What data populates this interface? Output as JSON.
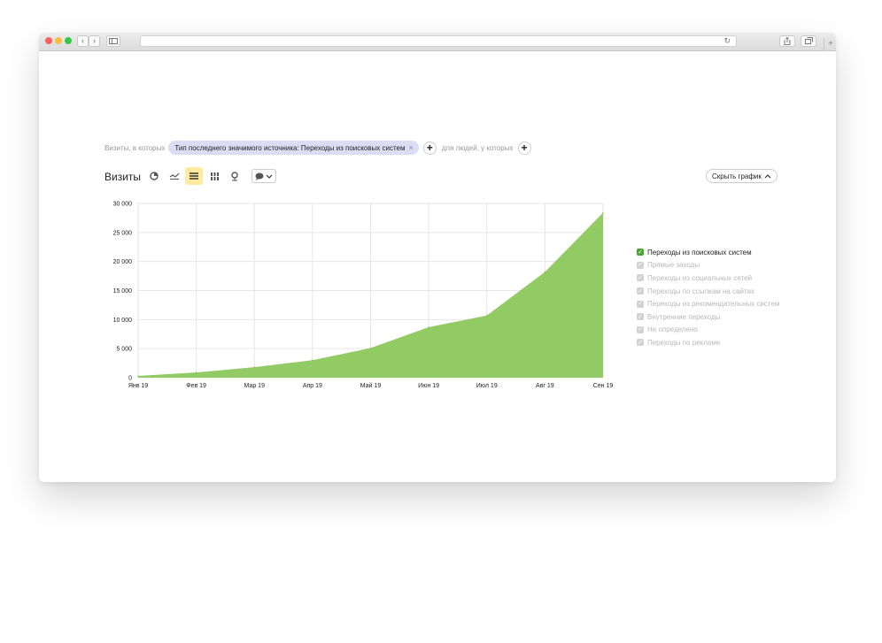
{
  "browser": {
    "back_glyph": "‹",
    "forward_glyph": "›",
    "reload_glyph": "↻",
    "icons": [
      "back-icon",
      "forward-icon",
      "sidebar-icon",
      "reload-icon",
      "share-icon",
      "tabs-icon",
      "new-tab-icon"
    ]
  },
  "filter": {
    "prefix": "Визиты, в которых",
    "chip_label": "Тип последнего значимого источника: Переходы из поисковых систем",
    "chip_remove": "×",
    "add": "+",
    "people_text": "для людей, у которых"
  },
  "header": {
    "title": "Визиты",
    "hide_button": "Скрыть график",
    "tool_icons": [
      "pie-chart-icon",
      "line-chart-icon",
      "stacked-area-icon",
      "bar-chart-icon",
      "map-pin-icon",
      "comment-icon"
    ],
    "active_tool": "stacked-area-icon"
  },
  "chart_data": {
    "type": "area",
    "title": "",
    "xlabel": "",
    "ylabel": "",
    "categories": [
      "Янв 19",
      "Фев 19",
      "Мар 19",
      "Апр 19",
      "Май 19",
      "Июн 19",
      "Июл 19",
      "Авг 19",
      "Сен 19"
    ],
    "series": [
      {
        "name": "Переходы из поисковых систем",
        "values": [
          300,
          900,
          1800,
          3000,
          5100,
          8700,
          10700,
          18200,
          28400
        ],
        "color": "#8cc75b"
      }
    ],
    "yticks": [
      "0",
      "5 000",
      "10 000",
      "15 000",
      "20 000",
      "25 000",
      "30 000"
    ],
    "ylim": [
      0,
      30000
    ],
    "grid": true,
    "legend_position": "right"
  },
  "legend": [
    {
      "label": "Переходы из поисковых систем",
      "checked": true,
      "active": true
    },
    {
      "label": "Прямые заходы",
      "checked": true,
      "active": false
    },
    {
      "label": "Переходы из социальных сетей",
      "checked": true,
      "active": false
    },
    {
      "label": "Переходы по ссылкам на сайтах",
      "checked": true,
      "active": false
    },
    {
      "label": "Переходы из рекомендательных систем",
      "checked": true,
      "active": false
    },
    {
      "label": "Внутренние переходы",
      "checked": true,
      "active": false
    },
    {
      "label": "Не определено",
      "checked": true,
      "active": false
    },
    {
      "label": "Переходы по рекламе",
      "checked": true,
      "active": false
    }
  ],
  "colors": {
    "accent_green": "#4aa52e",
    "area_fill": "#8cc75b",
    "chip_bg": "#dcdcf5",
    "active_tool_bg": "#ffeba0"
  }
}
